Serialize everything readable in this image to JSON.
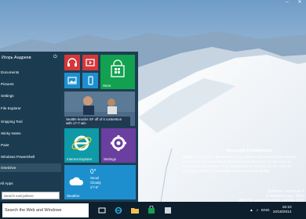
{
  "window": {
    "minimize": "–",
    "close": "✕"
  },
  "start_menu": {
    "user_name": "Игорь Андреев",
    "items": [
      {
        "label": "Documents",
        "icon": "folder-icon",
        "selected": false
      },
      {
        "label": "Pictures",
        "icon": "pictures-icon",
        "selected": false
      },
      {
        "label": "Settings",
        "icon": "gear-icon",
        "selected": false
      },
      {
        "label": "File Explorer",
        "icon": "folder-icon",
        "selected": false
      },
      {
        "label": "Snipping Tool",
        "icon": "scissors-icon",
        "selected": false
      },
      {
        "label": "Sticky Notes",
        "icon": "note-icon",
        "selected": false
      },
      {
        "label": "Paint",
        "icon": "palette-icon",
        "selected": false
      },
      {
        "label": "Windows PowerShell",
        "icon": "terminal-icon",
        "selected": false
      },
      {
        "label": "OneDrive",
        "icon": "cloud-icon",
        "selected": true
      }
    ],
    "all_apps": "All Apps",
    "search_placeholder": "Search everywhere"
  },
  "tiles": {
    "store": "Store",
    "news": "Seattle knocks SF off of it contention with 17-7 win",
    "internet_explorer": "Internet Explorer",
    "settings": "Settings",
    "weather": {
      "temp": "0°",
      "city": "Seoul",
      "condition": "Cloudy",
      "range": "2°/-8°",
      "label": "Weather"
    }
  },
  "taskbar": {
    "search_placeholder": "Search the Web and Windows",
    "language": "ENG",
    "time": "16:10",
    "date": "10/18/2014"
  },
  "watermark": {
    "title": "Microsoft Confidential",
    "body": "Unauthorized use or disclosure in any manner may result in disciplinary action up to and including termination of employment (in the case of employees), termination of an assignment or contract (in the case of contingent staff), and potential civil and criminal liability.",
    "line1": "Windows Technical P",
    "line2": "Evaluation copy. Build 9860.fbl_awesome1501.141010-1831"
  },
  "colors": {
    "accent_red": "#d5373b",
    "accent_green": "#12a150",
    "accent_blue": "#1d8fcf",
    "accent_purple": "#6b3fa0",
    "accent_teal": "#0e9aa7"
  }
}
